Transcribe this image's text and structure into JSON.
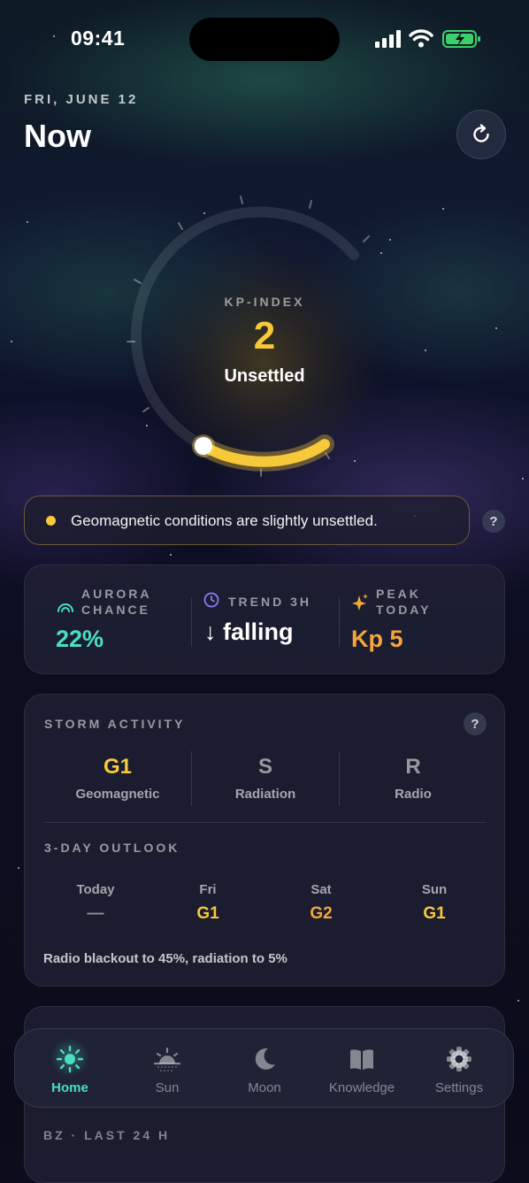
{
  "status_bar": {
    "time": "09:41"
  },
  "header": {
    "date": "FRI, JUNE 12",
    "title": "Now"
  },
  "kp": {
    "label": "KP-INDEX",
    "value": "2",
    "state": "Unsettled",
    "accent": "#f7c93a"
  },
  "banner": {
    "text": "Geomagnetic conditions are slightly unsettled.",
    "help": "?"
  },
  "stats": [
    {
      "label_line1": "AURORA",
      "label_line2": "CHANCE",
      "value": "22%",
      "color": "#48e0c0",
      "icon": "aurora-arc-icon"
    },
    {
      "label_line1": "TREND 3H",
      "label_line2": "",
      "value": "↓ falling",
      "color": "#ffffff",
      "icon": "clock-icon"
    },
    {
      "label_line1": "PEAK",
      "label_line2": "TODAY",
      "value": "Kp 5",
      "color": "#f5a53a",
      "icon": "sparkle-icon"
    }
  ],
  "storm": {
    "title": "STORM ACTIVITY",
    "help": "?",
    "scales": [
      {
        "code": "G1",
        "name": "Geomagnetic",
        "color": "#f7c93a"
      },
      {
        "code": "S",
        "name": "Radiation",
        "color": "rgba(255,255,255,0.55)"
      },
      {
        "code": "R",
        "name": "Radio",
        "color": "rgba(255,255,255,0.55)"
      }
    ],
    "outlook_title": "3-DAY OUTLOOK",
    "outlook": [
      {
        "day": "Today",
        "value": "—",
        "color": "rgba(255,255,255,0.5)"
      },
      {
        "day": "Fri",
        "value": "G1",
        "color": "#f7c93a"
      },
      {
        "day": "Sat",
        "value": "G2",
        "color": "#f5a53a"
      },
      {
        "day": "Sun",
        "value": "G1",
        "color": "#f7c93a"
      }
    ],
    "note": "Radio blackout to 45%, radiation to 5%"
  },
  "nav": [
    {
      "label": "Home",
      "icon": "sun-icon",
      "active": true
    },
    {
      "label": "Sun",
      "icon": "sunrise-icon",
      "active": false
    },
    {
      "label": "Moon",
      "icon": "moon-icon",
      "active": false
    },
    {
      "label": "Knowledge",
      "icon": "book-icon",
      "active": false
    },
    {
      "label": "Settings",
      "icon": "gear-icon",
      "active": false
    }
  ],
  "bz": {
    "label": "BZ · LAST 24 H"
  }
}
